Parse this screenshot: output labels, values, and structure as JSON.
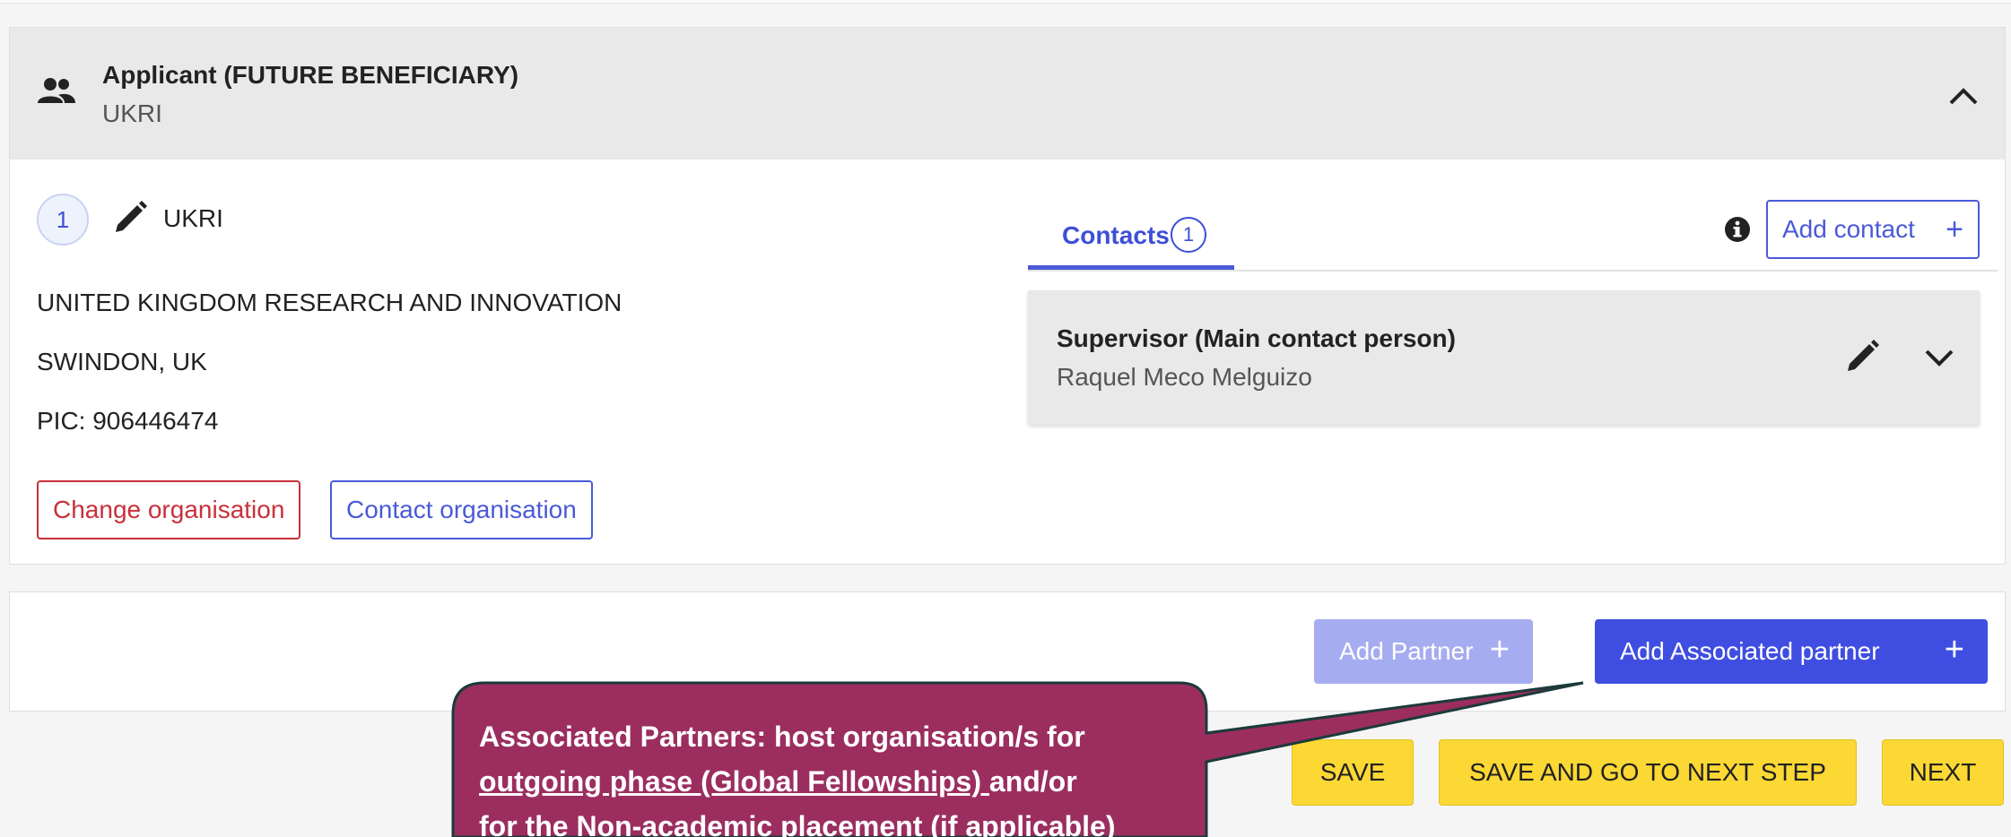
{
  "colors": {
    "accent_blue": "#3f4ee0",
    "disabled_blue": "#a5acf0",
    "danger_red": "#c9303a",
    "action_yellow": "#fbd834",
    "callout_fill": "#9b2e5f"
  },
  "applicant": {
    "title": "Applicant (FUTURE BENEFICIARY)",
    "subtitle": "UKRI",
    "header_icon": "people-icon",
    "collapse_icon": "chevron-up-icon",
    "index": "1",
    "short_name": "UKRI",
    "legal_name": "UNITED KINGDOM RESEARCH AND INNOVATION",
    "location": "SWINDON, UK",
    "pic": "PIC: 906446474",
    "change_org_label": "Change organisation",
    "contact_org_label": "Contact organisation"
  },
  "contacts": {
    "tab_label": "Contacts",
    "tab_count": "1",
    "add_contact_label": "Add contact",
    "add_icon": "+",
    "items": [
      {
        "role": "Supervisor (Main contact person)",
        "name": "Raquel Meco Melguizo"
      }
    ]
  },
  "partners": {
    "add_partner_label": "Add Partner",
    "add_associated_label": "Add Associated partner",
    "plus": "+"
  },
  "actions": {
    "save": "SAVE",
    "save_next": "SAVE AND GO TO NEXT STEP",
    "next": "NEXT"
  },
  "callout": {
    "line1": "Associated Partners: host organisation/s for",
    "line2_underlined": "outgoing phase (Global Fellowships) ",
    "line2_rest": "and/or",
    "line3": "for the Non-academic placement (if applicable)"
  }
}
